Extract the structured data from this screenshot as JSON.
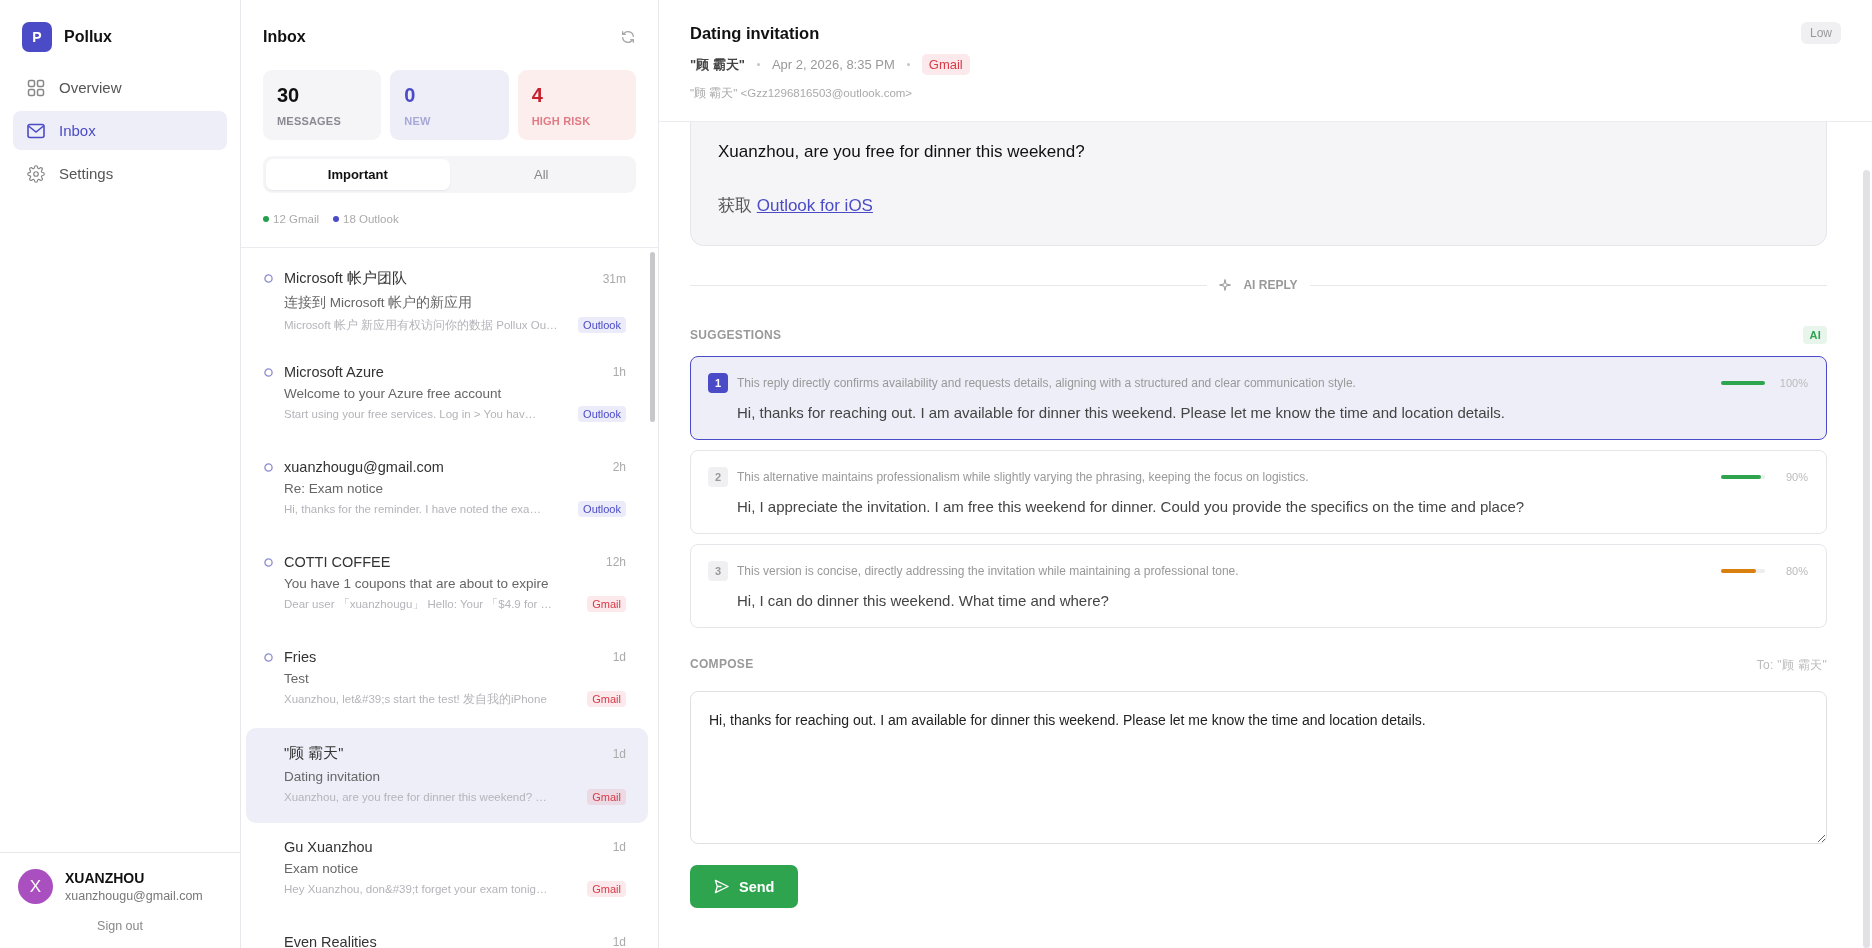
{
  "app": {
    "logo_letter": "P",
    "name": "Pollux"
  },
  "nav": [
    {
      "kind": "overview",
      "label": "Overview",
      "selected": false
    },
    {
      "kind": "inbox",
      "label": "Inbox",
      "selected": true
    },
    {
      "kind": "settings",
      "label": "Settings",
      "selected": false
    }
  ],
  "user": {
    "initial": "X",
    "name": "XUANZHOU",
    "email": "xuanzhougu@gmail.com",
    "sign_out": "Sign out"
  },
  "inbox": {
    "title": "Inbox",
    "stats": [
      {
        "kind": "total",
        "value": "30",
        "label": "MESSAGES"
      },
      {
        "kind": "new",
        "value": "0",
        "label": "NEW"
      },
      {
        "kind": "risk",
        "value": "4",
        "label": "HIGH RISK"
      }
    ],
    "tabs": [
      {
        "label": "Important",
        "selected": true
      },
      {
        "label": "All",
        "selected": false
      }
    ],
    "legend": [
      {
        "label": "12 Gmail",
        "color": "#22a04b"
      },
      {
        "label": "18 Outlook",
        "color": "#4b4bc8"
      }
    ],
    "messages": [
      {
        "sender": "Microsoft 帐户团队",
        "time": "31m",
        "subject": "连接到 Microsoft 帐户的新应用",
        "preview": "Microsoft 帐户 新应用有权访问你的数据 Pollux Ou…",
        "tag": {
          "label": "Outlook",
          "color": "#4b4bc8"
        },
        "unread": true,
        "selected": false
      },
      {
        "sender": "Microsoft Azure",
        "time": "1h",
        "subject": "Welcome to your Azure free account",
        "preview": "Start using your free services. Log in > You hav…",
        "tag": {
          "label": "Outlook",
          "color": "#4b4bc8"
        },
        "unread": true,
        "selected": false
      },
      {
        "sender": "xuanzhougu@gmail.com",
        "time": "2h",
        "subject": "Re: Exam notice",
        "preview": "Hi, thanks for the reminder. I have noted the exa…",
        "tag": {
          "label": "Outlook",
          "color": "#4b4bc8"
        },
        "unread": true,
        "selected": false
      },
      {
        "sender": "COTTI COFFEE",
        "time": "12h",
        "subject": "You have 1 coupons that are about to expire",
        "preview": "Dear user 「xuanzhougu」 Hello: Your 「$4.9 for …",
        "tag": {
          "label": "Gmail",
          "color": "#d93a48"
        },
        "unread": true,
        "selected": false
      },
      {
        "sender": "Fries",
        "time": "1d",
        "subject": "Test",
        "preview": "Xuanzhou, let&#39;s start the test! 发自我的iPhone",
        "tag": {
          "label": "Gmail",
          "color": "#d93a48"
        },
        "unread": true,
        "selected": false
      },
      {
        "sender": "\"顾 霸天\"",
        "time": "1d",
        "subject": "Dating invitation",
        "preview": "Xuanzhou, are you free for dinner this weekend? …",
        "tag": {
          "label": "Gmail",
          "color": "#d93a48"
        },
        "unread": false,
        "selected": true
      },
      {
        "sender": "Gu Xuanzhou",
        "time": "1d",
        "subject": "Exam notice",
        "preview": "Hey Xuanzhou, don&#39;t forget your exam tonig…",
        "tag": {
          "label": "Gmail",
          "color": "#d93a48"
        },
        "unread": false,
        "selected": false
      },
      {
        "sender": "Even Realities",
        "time": "1d",
        "unread": false,
        "selected": false
      }
    ]
  },
  "message": {
    "title": "Dating invitation",
    "sender": "\"顾 霸天\"",
    "date": "Apr 2, 2026, 8:35 PM",
    "tag": {
      "label": "Gmail",
      "color": "#d93a48"
    },
    "from": "\"顾 霸天\" <Gzz1296816503@outlook.com>",
    "priority": "Low",
    "body": {
      "text": "Xuanzhou, are you free for dinner this weekend?",
      "prefix": "获取",
      "link": "Outlook for iOS"
    }
  },
  "ai_reply": {
    "divider": "AI REPLY",
    "label": "SUGGESTIONS",
    "badge": "AI",
    "suggestions": [
      {
        "number": "1",
        "rationale": "This reply directly confirms availability and requests details, aligning with a structured and clear communication style.",
        "text": "Hi, thanks for reaching out. I am available for dinner this weekend. Please let me know the time and location details.",
        "level": 1.0,
        "reading": "100%",
        "color": "#2ea44f",
        "selected": true
      },
      {
        "number": "2",
        "rationale": "This alternative maintains professionalism while slightly varying the phrasing, keeping the focus on logistics.",
        "text": "Hi, I appreciate the invitation. I am free this weekend for dinner. Could you provide the specifics on the time and place?",
        "level": 0.9,
        "reading": "90%",
        "color": "#2ea44f",
        "selected": false
      },
      {
        "number": "3",
        "rationale": "This version is concise, directly addressing the invitation while maintaining a professional tone.",
        "text": "Hi, I can do dinner this weekend. What time and where?",
        "level": 0.8,
        "reading": "80%",
        "color": "#d97f10",
        "selected": false
      }
    ]
  },
  "compose": {
    "label": "COMPOSE",
    "to": "To: \"顾 霸天\"",
    "value": "Hi, thanks for reaching out. I am available for dinner this weekend. Please let me know the time and location details.",
    "send": "Send"
  }
}
